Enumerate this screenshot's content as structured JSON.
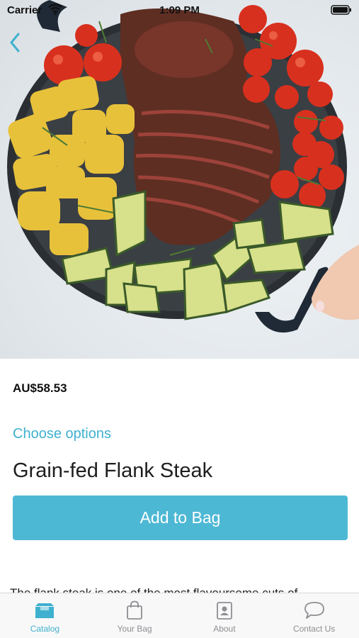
{
  "status_bar": {
    "carrier": "Carrier",
    "time": "1:09 PM"
  },
  "product": {
    "price": "AU$58.53",
    "choose_options_label": "Choose options",
    "title": "Grain-fed Flank Steak",
    "add_to_bag_label": "Add to Bag",
    "description": "The flank steak is one of the most flavoursome cuts of"
  },
  "tab_bar": {
    "tabs": [
      {
        "label": "Catalog",
        "icon": "catalog-icon",
        "active": true
      },
      {
        "label": "Your Bag",
        "icon": "bag-icon",
        "active": false
      },
      {
        "label": "About",
        "icon": "about-icon",
        "active": false
      },
      {
        "label": "Contact Us",
        "icon": "chat-icon",
        "active": false
      }
    ]
  },
  "colors": {
    "accent": "#3fb1cf",
    "button": "#4db8d4",
    "tab_inactive": "#8e8e93"
  }
}
